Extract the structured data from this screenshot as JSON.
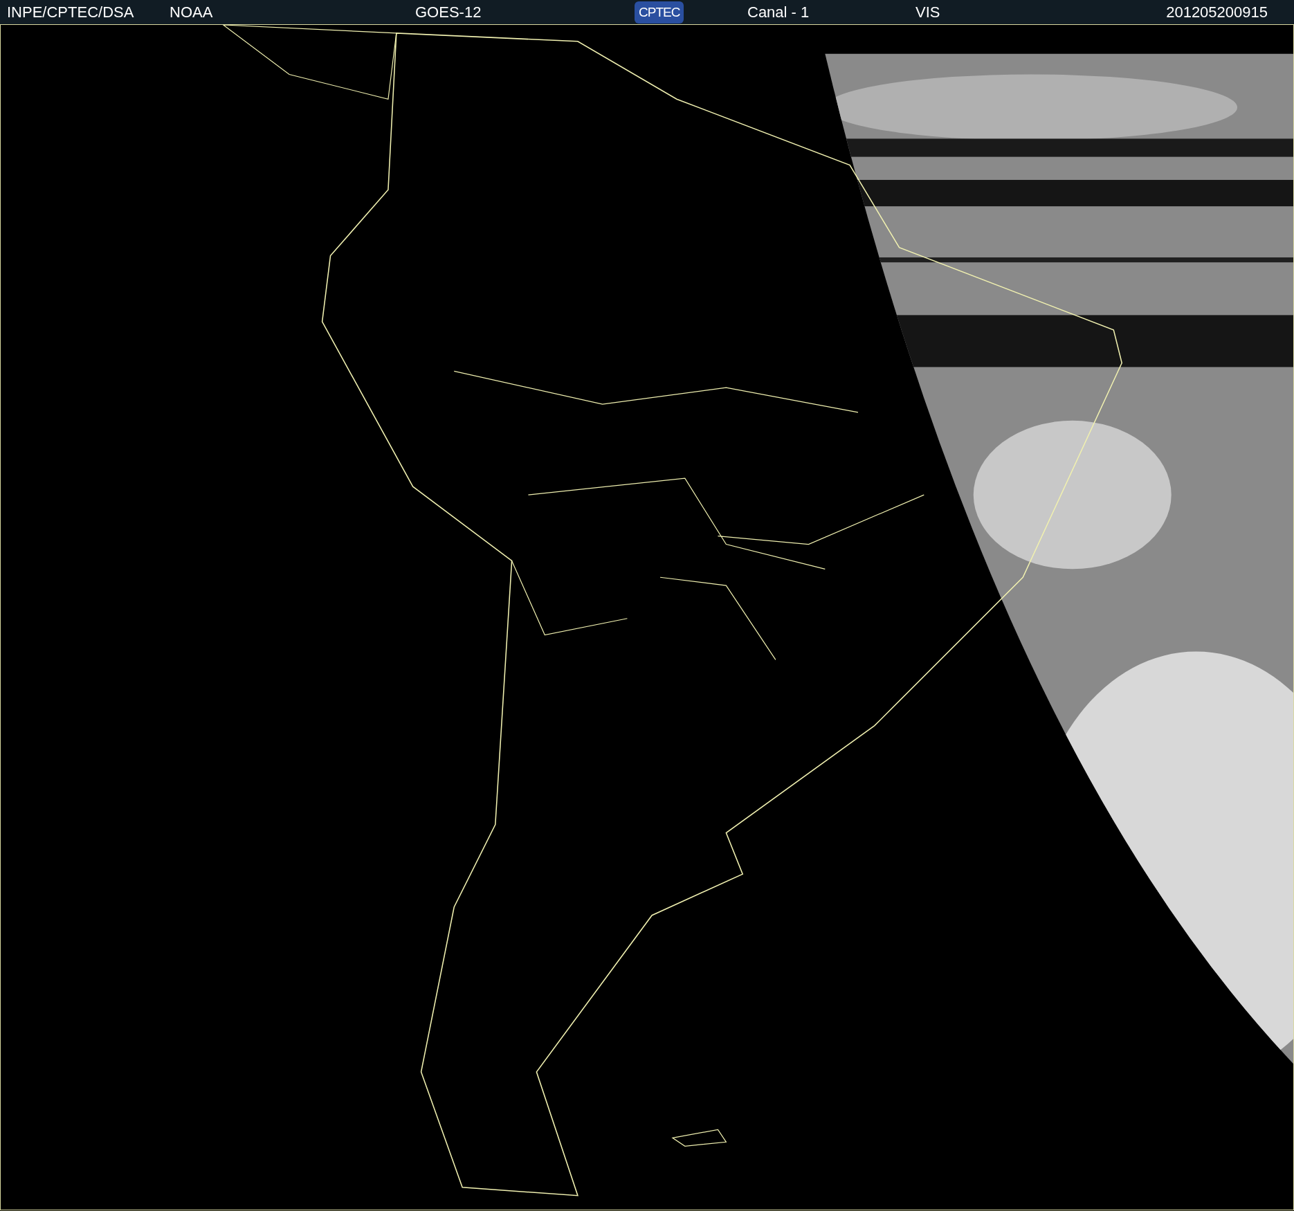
{
  "header": {
    "source": "INPE/CPTEC/DSA",
    "agency": "NOAA",
    "satellite": "GOES-12",
    "logo": "CPTEC",
    "channel": "Canal - 1",
    "band": "VIS",
    "timestamp": "201205200915"
  }
}
